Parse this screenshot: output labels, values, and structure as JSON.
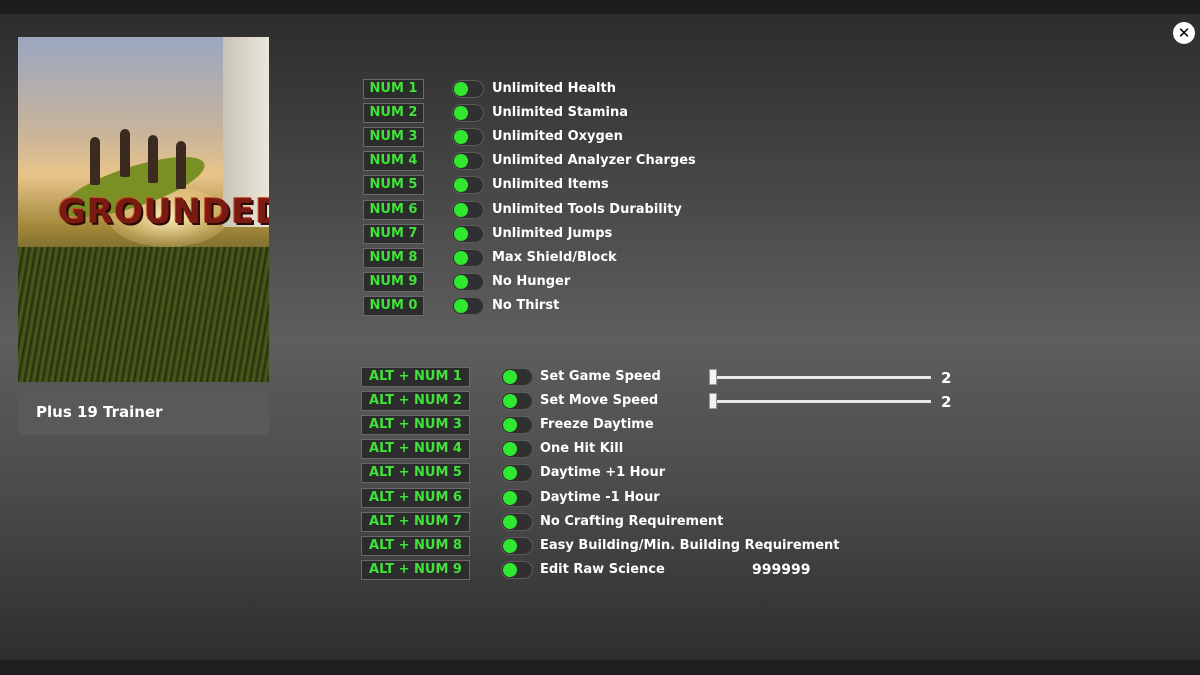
{
  "window": {
    "close_icon": "close-icon"
  },
  "sidebar": {
    "cover_logo": "GROUNDED",
    "trainer_label": "Plus 19 Trainer"
  },
  "colors": {
    "key_text": "#41e23c",
    "toggle_on": "#2fe82f",
    "label": "#ffffff"
  },
  "group1": [
    {
      "key": "NUM 1",
      "label": "Unlimited Health"
    },
    {
      "key": "NUM 2",
      "label": "Unlimited Stamina"
    },
    {
      "key": "NUM 3",
      "label": "Unlimited Oxygen"
    },
    {
      "key": "NUM 4",
      "label": "Unlimited Analyzer Charges"
    },
    {
      "key": "NUM 5",
      "label": "Unlimited Items"
    },
    {
      "key": "NUM 6",
      "label": "Unlimited Tools Durability"
    },
    {
      "key": "NUM 7",
      "label": "Unlimited Jumps"
    },
    {
      "key": "NUM 8",
      "label": "Max Shield/Block"
    },
    {
      "key": "NUM 9",
      "label": "No Hunger"
    },
    {
      "key": "NUM 0",
      "label": "No Thirst"
    }
  ],
  "group2": [
    {
      "key": "ALT + NUM 1",
      "label": "Set Game Speed",
      "slider_value": "2"
    },
    {
      "key": "ALT + NUM 2",
      "label": "Set Move Speed",
      "slider_value": "2"
    },
    {
      "key": "ALT + NUM 3",
      "label": "Freeze Daytime"
    },
    {
      "key": "ALT + NUM 4",
      "label": "One Hit Kill"
    },
    {
      "key": "ALT + NUM 5",
      "label": "Daytime +1 Hour"
    },
    {
      "key": "ALT + NUM 6",
      "label": "Daytime -1 Hour"
    },
    {
      "key": "ALT + NUM 7",
      "label": "No Crafting Requirement"
    },
    {
      "key": "ALT + NUM 8",
      "label": "Easy Building/Min. Building Requirement"
    },
    {
      "key": "ALT + NUM 9",
      "label": "Edit Raw Science",
      "edit_value": "999999"
    }
  ]
}
